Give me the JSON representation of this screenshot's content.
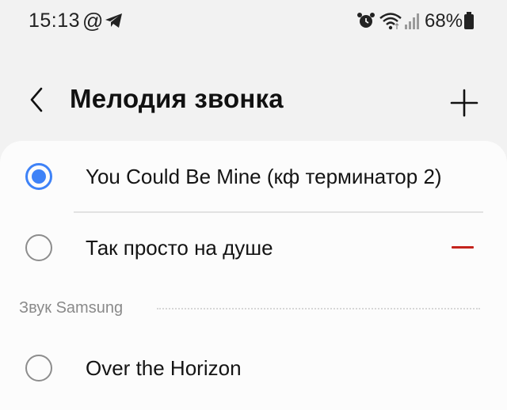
{
  "status_bar": {
    "time": "15:13",
    "at_symbol": "@",
    "icons": [
      "at-icon",
      "telegram-icon",
      "alarm-icon",
      "wifi-icon",
      "signal-icon",
      "battery-icon"
    ],
    "battery_percent": "68%"
  },
  "header": {
    "title": "Мелодия звонка",
    "back_icon": "chevron-left-icon",
    "add_icon": "plus-icon"
  },
  "ringtones": [
    {
      "label": "You Could Be Mine (кф терминатор 2)",
      "selected": true
    },
    {
      "label": "Так просто на душе",
      "selected": false,
      "removable": true
    }
  ],
  "section": {
    "label": "Звук Samsung",
    "items": [
      {
        "label": "Over the Horizon",
        "selected": false
      }
    ]
  },
  "colors": {
    "accent": "#3e82f7",
    "delete": "#c4231c",
    "background": "#f2f2f2",
    "card": "#fcfcfc"
  }
}
